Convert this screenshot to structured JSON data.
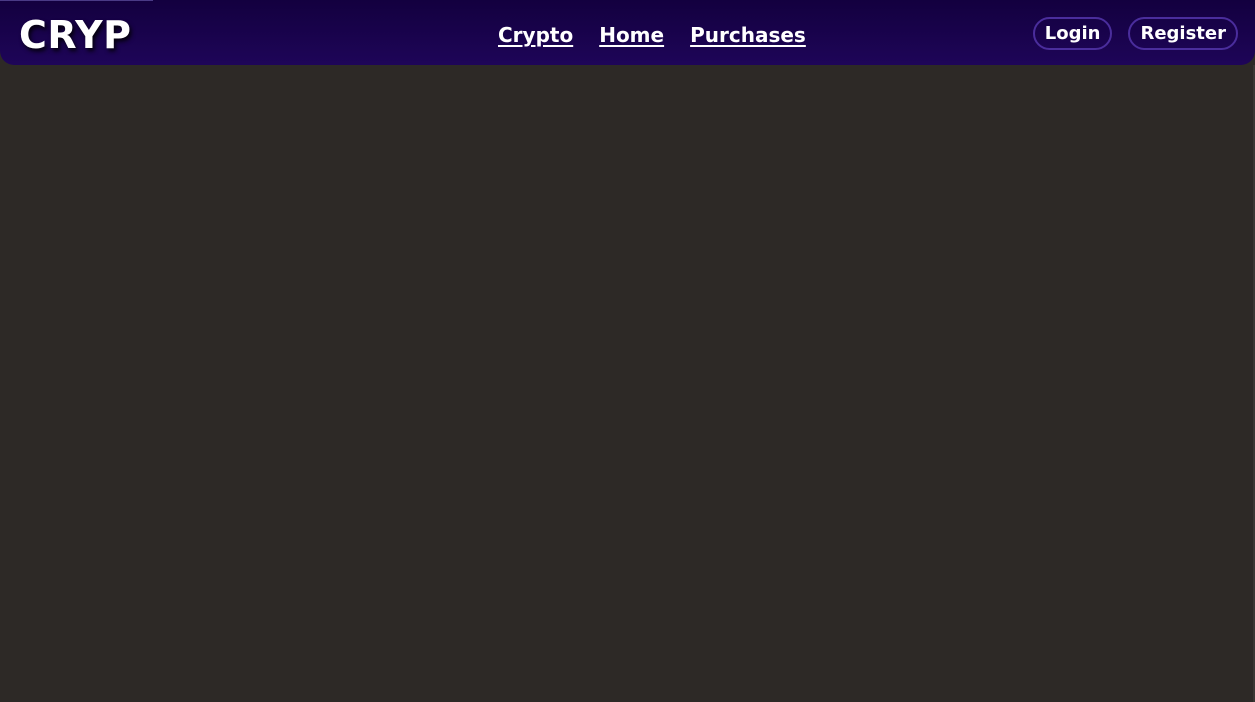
{
  "brand": {
    "logo_text": "CRYP"
  },
  "nav": {
    "links": [
      {
        "label": "Crypto"
      },
      {
        "label": "Home"
      },
      {
        "label": "Purchases"
      }
    ]
  },
  "auth": {
    "login_label": "Login",
    "register_label": "Register"
  },
  "colors": {
    "navbar_top": "#13003f",
    "navbar_bottom": "#1e0558",
    "page_background": "#2d2926",
    "button_border": "#4a2d9c",
    "text": "#ffffff"
  }
}
